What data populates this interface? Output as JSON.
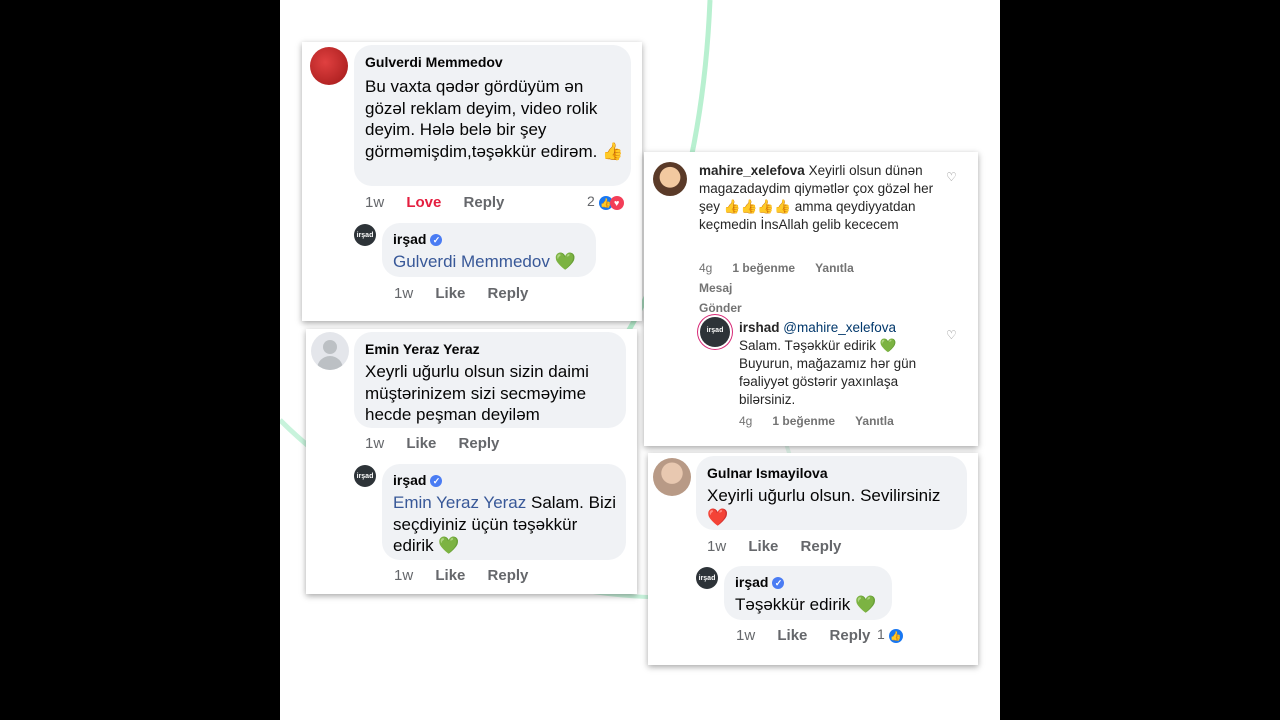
{
  "colors": {
    "accent": "#4a7cf3",
    "love": "#e41e3f",
    "mention": "#385898",
    "deco_line": "#b8f0d0"
  },
  "c1": {
    "name": "Gulverdi Memmedov",
    "text": "Bu vaxta qədər gördüyüm ən gözəl reklam deyim, video rolik deyim. Hələ belə bir şey görməmişdim,təşəkkür edirəm.",
    "emoji": "👍",
    "time": "1w",
    "love": "Love",
    "reply": "Reply",
    "reaction_count": "2",
    "reply_item": {
      "name": "irşad",
      "mention": "Gulverdi Memmedov",
      "emoji": "💚",
      "time": "1w",
      "like": "Like",
      "reply": "Reply"
    }
  },
  "c2": {
    "name": "Emin Yeraz Yeraz",
    "text": "Xeyrli uğurlu olsun sizin daimi müştərinizem sizi secməyime hecde peşman deyiləm",
    "time": "1w",
    "like": "Like",
    "reply": "Reply",
    "reply_item": {
      "name": "irşad",
      "mention": "Emin Yeraz Yeraz",
      "text": " Salam. Bizi seçdiyiniz üçün təşəkkür edirik",
      "emoji": "💚",
      "time": "1w",
      "like": "Like",
      "reply": "Reply"
    }
  },
  "c3": {
    "username": "mahire_xelefova",
    "text": "Xeyirli olsun dünən magazadaydim qiymətlər çox gözəl her şey 👍👍👍👍 amma qeydiyyatdan keçmedin İnsAllah gelib kececem",
    "time": "4g",
    "likes": "1 beğenme",
    "reply": "Yanıtla",
    "message": "Mesaj Gönder",
    "reply_item": {
      "username": "irshad",
      "mention": "@mahire_xelefova",
      "text": "Salam. Təşəkkür edirik 💚 Buyurun, mağazamız hər gün fəaliyyət göstərir yaxınlaşa bilərsiniz.",
      "time": "4g",
      "likes": "1 beğenme",
      "reply": "Yanıtla"
    }
  },
  "c4": {
    "name": "Gulnar Ismayilova",
    "text": "Xeyirli uğurlu olsun. Sevilirsiniz",
    "emoji": "❤️",
    "time": "1w",
    "like": "Like",
    "reply": "Reply",
    "reply_item": {
      "name": "irşad",
      "text": "Təşəkkür edirik",
      "emoji": "💚",
      "time": "1w",
      "like": "Like",
      "reply": "Reply",
      "reaction_count": "1"
    }
  },
  "brand_avatar_text": "irşad"
}
